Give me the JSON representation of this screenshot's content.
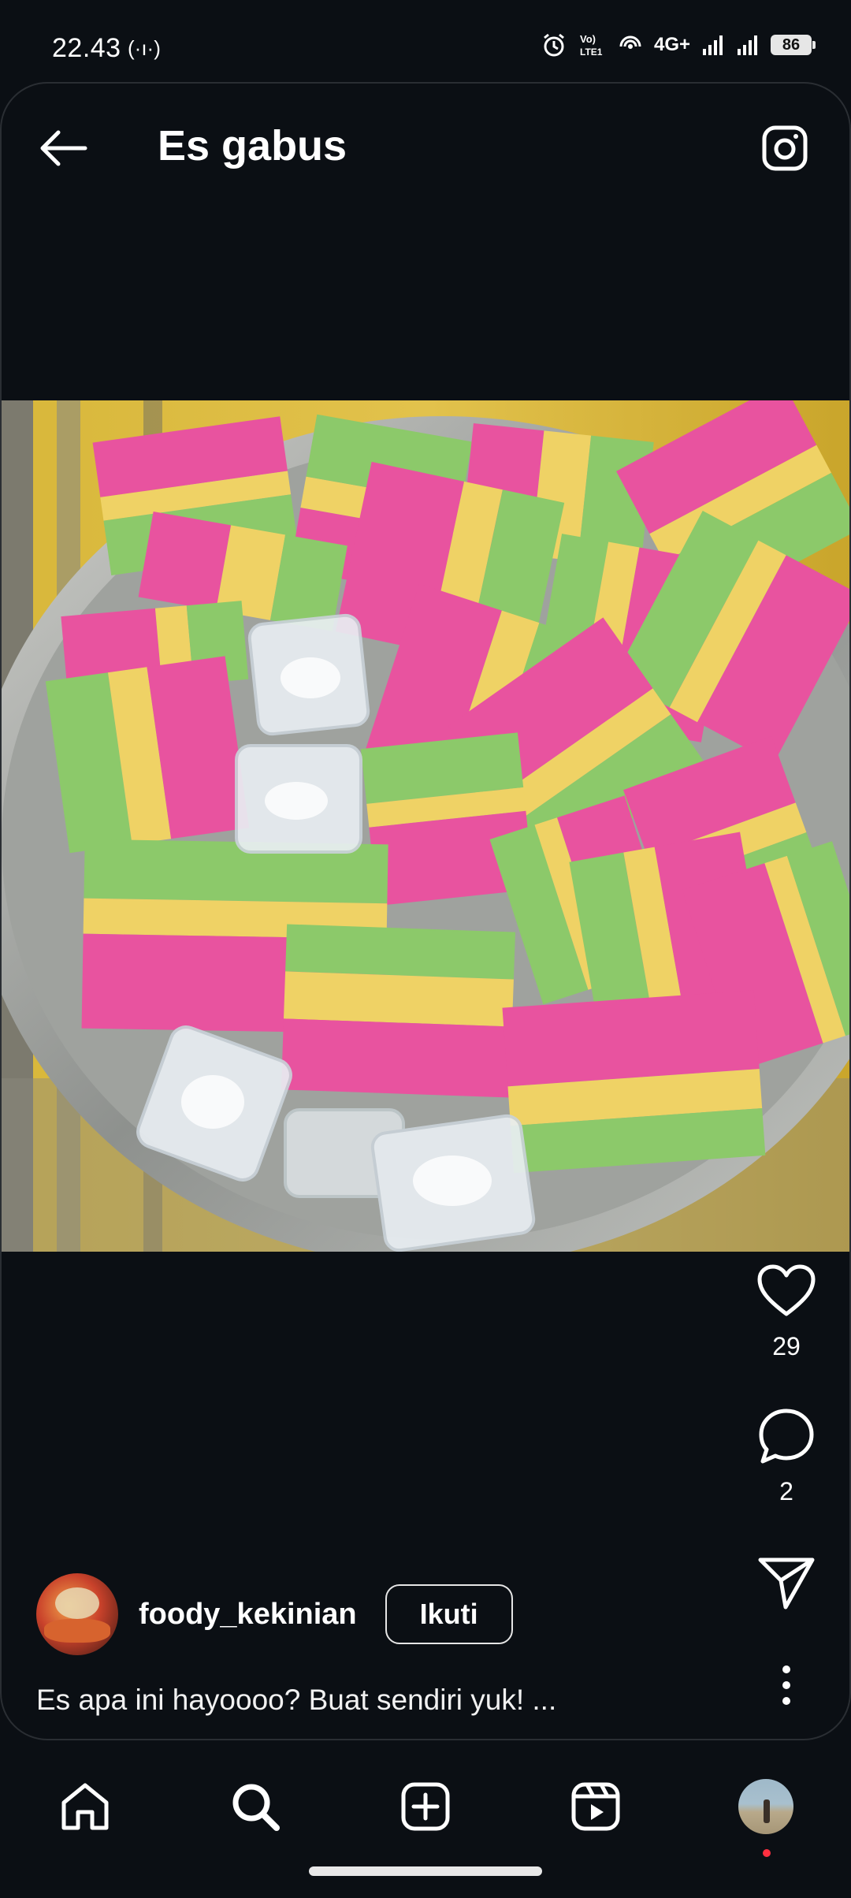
{
  "status_bar": {
    "time": "22.43",
    "network": "4G+",
    "battery": "86"
  },
  "header": {
    "title": "Es gabus",
    "back_icon": "arrow-left-icon",
    "camera_icon": "camera-icon"
  },
  "post": {
    "image_icon": "es-gabus-photo",
    "likes": "29",
    "comments": "2",
    "author": "foody_kekinian",
    "follow_label": "Ikuti",
    "caption": "Es apa ini hayoooo? Buat sendiri yuk! ..."
  },
  "nav": {
    "items": [
      "home-icon",
      "search-icon",
      "create-icon",
      "reels-icon",
      "profile-avatar"
    ]
  },
  "colors": {
    "background": "#0b0f14",
    "pink": "#e8539f",
    "yellow": "#efd265",
    "green": "#8cc96a",
    "notification_dot": "#ff3040"
  }
}
